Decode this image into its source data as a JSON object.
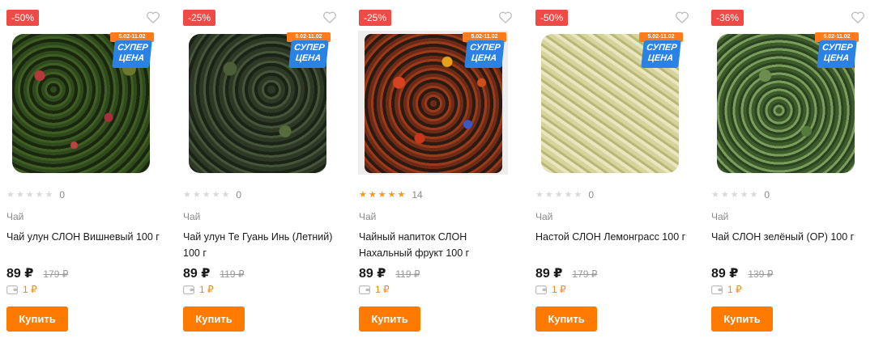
{
  "colors": {
    "accent": "#ff7a00",
    "discount": "#f04a46",
    "star": "#f29b15",
    "promo_blue": "#2a82e4"
  },
  "promo": {
    "dates": "5.02-11.02",
    "line1": "СУПЕР",
    "line2": "ЦЕНА"
  },
  "buy_label": "Купить",
  "products": [
    {
      "discount": "-50%",
      "rating": 0,
      "reviews": "0",
      "category": "Чай",
      "title": "Чай улун СЛОН Вишневый 100 г",
      "price": "89 ₽",
      "old_price": "179 ₽",
      "cashback": "1 ₽",
      "image": "cherry-oolong-tea"
    },
    {
      "discount": "-25%",
      "rating": 0,
      "reviews": "0",
      "category": "Чай",
      "title": "Чай улун Те Гуань Инь (Летний) 100 г",
      "price": "89 ₽",
      "old_price": "119 ₽",
      "cashback": "1 ₽",
      "image": "tie-guan-yin-tea"
    },
    {
      "discount": "-25%",
      "rating": 5,
      "reviews": "14",
      "category": "Чай",
      "title": "Чайный напиток СЛОН Нахальный фрукт 100 г",
      "price": "89 ₽",
      "old_price": "119 ₽",
      "cashback": "1 ₽",
      "image": "fruit-tea"
    },
    {
      "discount": "-50%",
      "rating": 0,
      "reviews": "0",
      "category": "Чай",
      "title": "Настой СЛОН Лемонграсс 100 г",
      "price": "89 ₽",
      "old_price": "179 ₽",
      "cashback": "1 ₽",
      "image": "lemongrass"
    },
    {
      "discount": "-36%",
      "rating": 0,
      "reviews": "0",
      "category": "Чай",
      "title": "Чай СЛОН зелёный (ОР) 100 г",
      "price": "89 ₽",
      "old_price": "139 ₽",
      "cashback": "1 ₽",
      "image": "green-tea"
    }
  ]
}
